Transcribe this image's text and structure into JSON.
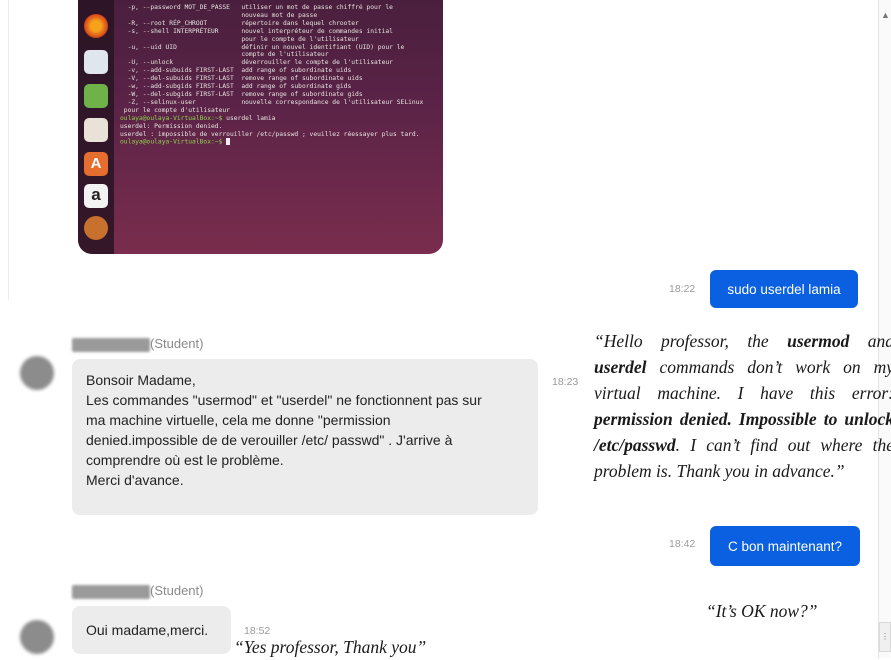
{
  "terminal": {
    "lines": [
      "  -p, --password MOT_DE_PASSE   utiliser un mot de passe chiffré pour le",
      "                                nouveau mot de passe",
      "  -R, --root RÉP_CHROOT         répertoire dans lequel chrooter",
      "  -s, --shell INTERPRÉTEUR      nouvel interpréteur de commandes initial",
      "                                pour le compte de l'utilisateur",
      "  -u, --uid UID                 définir un nouvel identifiant (UID) pour le",
      "                                compte de l'utilisateur",
      "  -U, --unlock                  déverrouiller le compte de l'utilisateur",
      "  -v, --add-subuids FIRST-LAST  add range of subordinate uids",
      "  -V, --del-subuids FIRST-LAST  remove range of subordinate uids",
      "  -w, --add-subgids FIRST-LAST  add range of subordinate gids",
      "  -W, --del-subgids FIRST-LAST  remove range of subordinate gids",
      "  -Z, --selinux-user            nouvelle correspondance de l'utilisateur SELinux",
      " pour le compte d'utilisateur"
    ],
    "prompt1": "oulaya@oulaya-VirtualBox:~$",
    "cmd1": " userdel lamia",
    "out1": "userdel: Permission denied.",
    "out2": "userdel : impossible de verrouiller /etc/passwd ; veuillez réessayer plus tard.",
    "prompt2": "oulaya@oulaya-VirtualBox:~$"
  },
  "messages": {
    "out1": {
      "time": "18:22",
      "text": "sudo userdel lamia"
    },
    "in1": {
      "role": "(Student)",
      "time": "18:23",
      "lines": [
        "Bonsoir Madame,",
        "Les commandes \"usermod\" et \"userdel\" ne fonctionnent pas sur",
        "ma machine virtuelle, cela me donne \"permission",
        "denied.impossible de de verouiller /etc/ passwd\" . J'arrive à",
        "comprendre où est le problème.",
        "Merci d'avance."
      ]
    },
    "out2": {
      "time": "18:42",
      "text": "C bon maintenant?"
    },
    "in2": {
      "role": "(Student)",
      "time": "18:52",
      "text": "Oui madame,merci."
    }
  },
  "translations": {
    "t1": {
      "p1": "“Hello professor, the ",
      "b1": "usermod",
      "p2": " and ",
      "b2": "userdel",
      "p3": " commands don’t work on my virtual machine. I have this error: ",
      "b3": "permission denied. Impossible to unlock /etc/passwd",
      "p4": ". I can’t find out where the problem is. Thank you in advance.”"
    },
    "t2": "“It’s OK now?”",
    "t3": "“Yes professor, Thank you”"
  }
}
